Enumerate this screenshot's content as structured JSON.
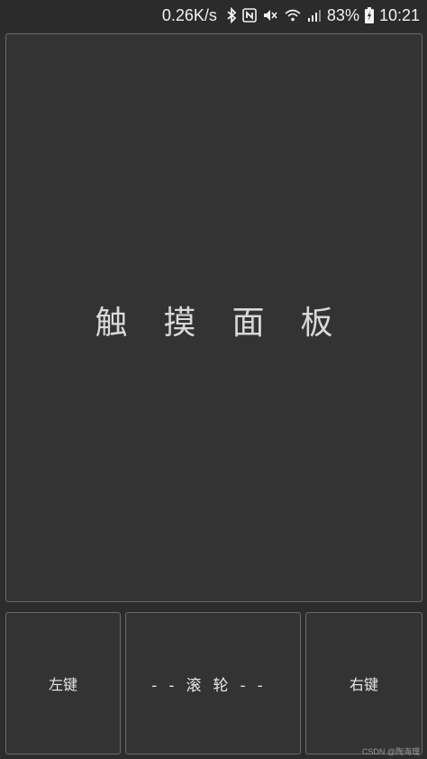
{
  "status_bar": {
    "net_speed": "0.26K/s",
    "battery_percent": "83%",
    "time": "10:21",
    "icons": [
      "bluetooth-icon",
      "nfc-icon",
      "mute-icon",
      "wifi-icon",
      "signal-icon",
      "battery-icon"
    ]
  },
  "touchpad": {
    "label": "触摸面板"
  },
  "buttons": {
    "left_label": "左键",
    "scroll_label": "--滚轮--",
    "right_label": "右键"
  },
  "watermark": "CSDN @陶海理",
  "colors": {
    "background": "#2c2c2c",
    "panel": "#333333",
    "border": "#6a6a6a",
    "text": "#e6e6e6"
  }
}
